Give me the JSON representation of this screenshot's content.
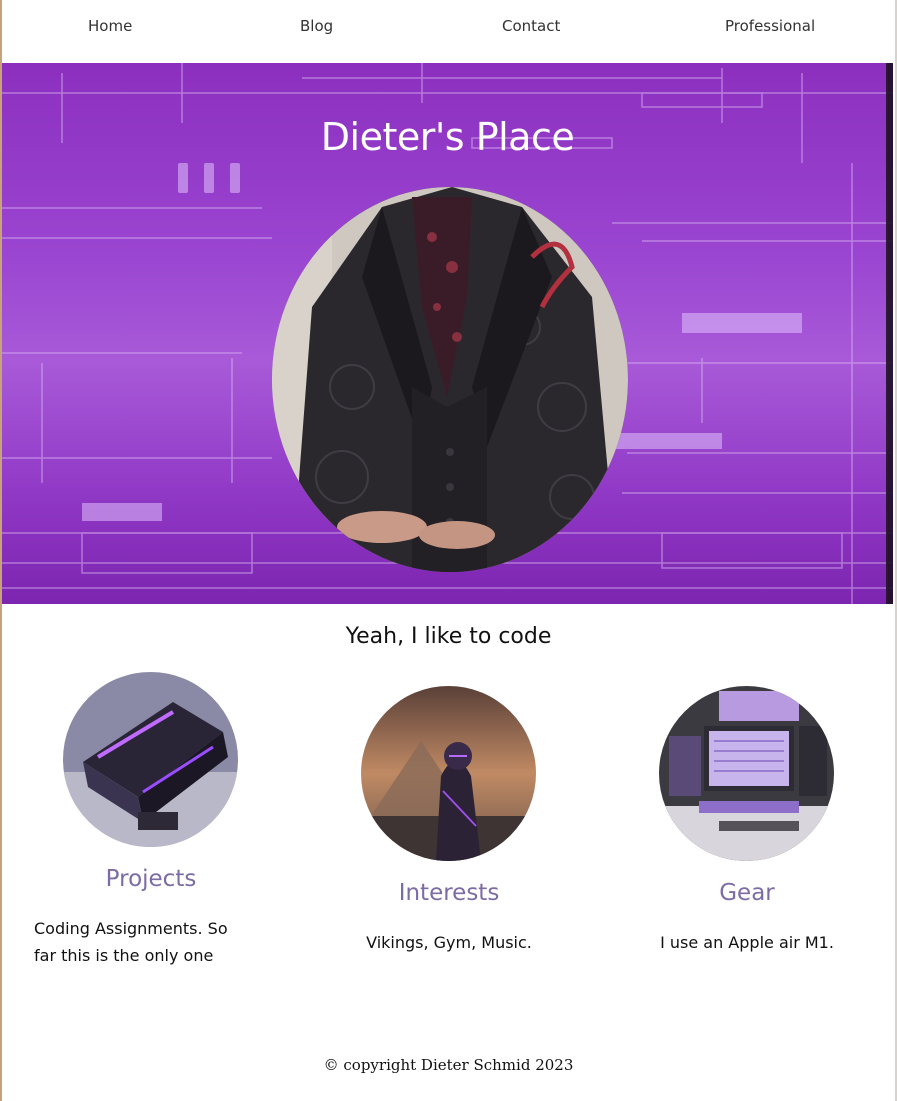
{
  "nav": {
    "items": [
      {
        "label": "Home"
      },
      {
        "label": "Blog"
      },
      {
        "label": "Contact"
      },
      {
        "label": "Professional"
      }
    ]
  },
  "hero": {
    "title": "Dieter's Place"
  },
  "tagline": "Yeah, I like to code",
  "cards": [
    {
      "title": "Projects",
      "description": "Coding Assignments. So far this is the only one"
    },
    {
      "title": "Interests",
      "description": "Vikings, Gym, Music."
    },
    {
      "title": "Gear",
      "description": "I use an Apple air M1."
    }
  ],
  "footer": {
    "copyright": "© copyright Dieter Schmid 2023"
  },
  "colors": {
    "hero_purple": "#9a45d1",
    "card_title": "#7d6ba6",
    "text": "#111111"
  }
}
